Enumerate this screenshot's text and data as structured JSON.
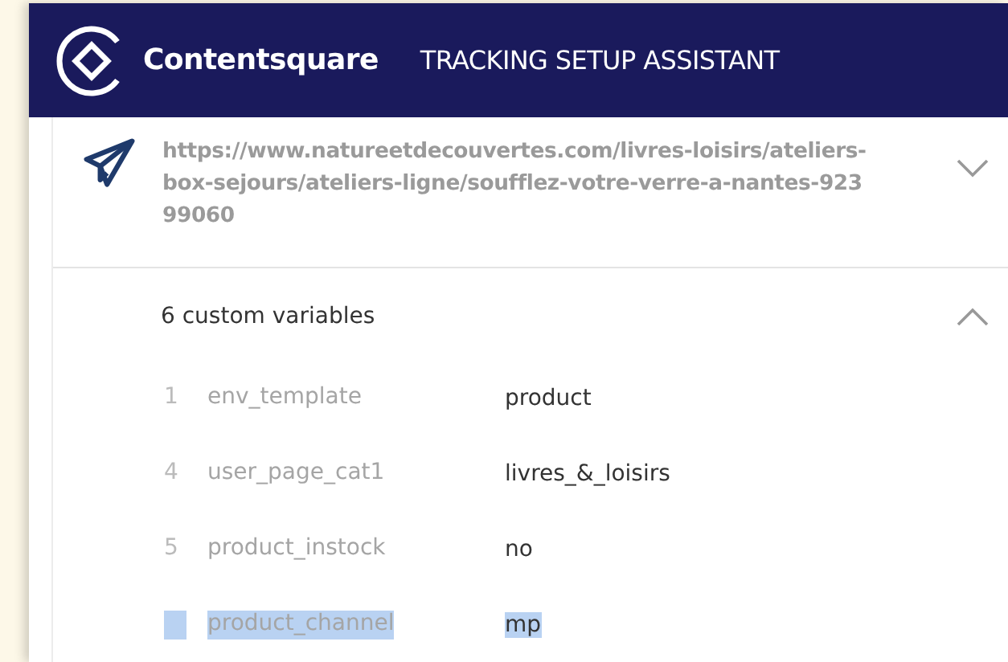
{
  "header": {
    "brand": "Contentsquare",
    "title": "TRACKING SETUP ASSISTANT"
  },
  "page": {
    "url": "https://www.natureetdecouvertes.com/livres-loisirs/ateliers-box-sejours/ateliers-ligne/soufflez-votre-verre-a-nantes-92399060",
    "expanded": false
  },
  "variables": {
    "title": "6 custom variables",
    "expanded": true,
    "rows": [
      {
        "index": "1",
        "name": "env_template",
        "value": "product",
        "selected": false
      },
      {
        "index": "4",
        "name": "user_page_cat1",
        "value": "livres_&_loisirs",
        "selected": false
      },
      {
        "index": "5",
        "name": "product_instock",
        "value": "no",
        "selected": false
      },
      {
        "name": "product_channel",
        "value": "mp",
        "selected": true
      }
    ]
  }
}
